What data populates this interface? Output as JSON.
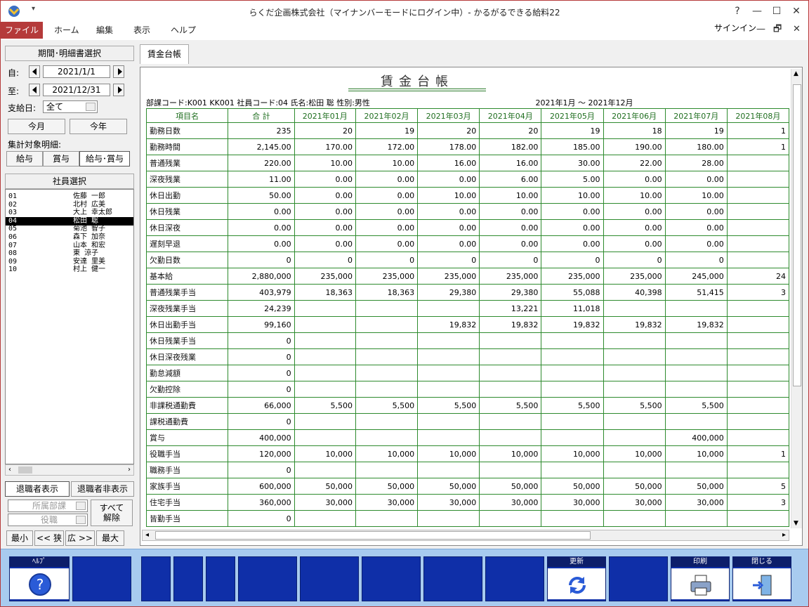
{
  "window": {
    "title": "らくだ企画株式会社（マイナンバーモードにログイン中）- かるがるできる給料22",
    "help_btn": "?",
    "min_btn": "—",
    "max_btn": "☐",
    "close_btn": "✕"
  },
  "menu": {
    "file": "ファイル",
    "home": "ホーム",
    "edit": "編集",
    "view": "表示",
    "help": "ヘルプ",
    "signin": "サインイン",
    "sub_min": "—",
    "sub_max": "🗗",
    "sub_close": "✕"
  },
  "left": {
    "period_head": "期間･明細書選択",
    "from_label": "自:",
    "from_date": "2021/1/1",
    "to_label": "至:",
    "to_date": "2021/12/31",
    "payday_label": "支給日:",
    "payday_value": "全て",
    "this_month": "今月",
    "this_year": "今年",
    "target_label": "集計対象明細:",
    "salary": "給与",
    "bonus": "賞与",
    "salary_bonus": "給与･賞与",
    "emp_head": "社員選択",
    "employees": [
      {
        "code": "01",
        "name": "佐藤 一郎"
      },
      {
        "code": "02",
        "name": "北村 広美"
      },
      {
        "code": "03",
        "name": "大上 幸太郎"
      },
      {
        "code": "04",
        "name": "松田 聡"
      },
      {
        "code": "05",
        "name": "菊池 智子"
      },
      {
        "code": "06",
        "name": "森下 加奈"
      },
      {
        "code": "07",
        "name": "山本 和宏"
      },
      {
        "code": "08",
        "name": "東 涼子"
      },
      {
        "code": "09",
        "name": "安達 里美"
      },
      {
        "code": "10",
        "name": "村上 健一"
      }
    ],
    "retired_show": "退職者表示",
    "retired_hide": "退職者非表示",
    "dept_placeholder": "所属部課",
    "role_placeholder": "役職",
    "clear_all": "すべて\n解除",
    "zoom_min": "最小",
    "zoom_narrow": "<< 狭",
    "zoom_wide": "広 >>",
    "zoom_max": "最大"
  },
  "sheet": {
    "tab": "賃金台帳",
    "title": "賃金台帳",
    "info": "部課コード:K001 KK001  社員コード:04  氏名:松田 聡  性別:男性",
    "period": "2021年1月 〜 2021年12月",
    "headers": [
      "項目名",
      "合 計",
      "2021年01月",
      "2021年02月",
      "2021年03月",
      "2021年04月",
      "2021年05月",
      "2021年06月",
      "2021年07月",
      "2021年08月"
    ],
    "rows": [
      [
        "勤務日数",
        "235",
        "20",
        "19",
        "20",
        "20",
        "19",
        "18",
        "19",
        "1"
      ],
      [
        "勤務時間",
        "2,145.00",
        "170.00",
        "172.00",
        "178.00",
        "182.00",
        "185.00",
        "190.00",
        "180.00",
        "1"
      ],
      [
        "普通残業",
        "220.00",
        "10.00",
        "10.00",
        "16.00",
        "16.00",
        "30.00",
        "22.00",
        "28.00",
        ""
      ],
      [
        "深夜残業",
        "11.00",
        "0.00",
        "0.00",
        "0.00",
        "6.00",
        "5.00",
        "0.00",
        "0.00",
        ""
      ],
      [
        "休日出勤",
        "50.00",
        "0.00",
        "0.00",
        "10.00",
        "10.00",
        "10.00",
        "10.00",
        "10.00",
        ""
      ],
      [
        "休日残業",
        "0.00",
        "0.00",
        "0.00",
        "0.00",
        "0.00",
        "0.00",
        "0.00",
        "0.00",
        ""
      ],
      [
        "休日深夜",
        "0.00",
        "0.00",
        "0.00",
        "0.00",
        "0.00",
        "0.00",
        "0.00",
        "0.00",
        ""
      ],
      [
        "遅刻早退",
        "0.00",
        "0.00",
        "0.00",
        "0.00",
        "0.00",
        "0.00",
        "0.00",
        "0.00",
        ""
      ],
      [
        "欠勤日数",
        "0",
        "0",
        "0",
        "0",
        "0",
        "0",
        "0",
        "0",
        ""
      ],
      [
        "基本給",
        "2,880,000",
        "235,000",
        "235,000",
        "235,000",
        "235,000",
        "235,000",
        "235,000",
        "245,000",
        "24"
      ],
      [
        "普通残業手当",
        "403,979",
        "18,363",
        "18,363",
        "29,380",
        "29,380",
        "55,088",
        "40,398",
        "51,415",
        "3"
      ],
      [
        "深夜残業手当",
        "24,239",
        "",
        "",
        "",
        "13,221",
        "11,018",
        "",
        "",
        ""
      ],
      [
        "休日出勤手当",
        "99,160",
        "",
        "",
        "19,832",
        "19,832",
        "19,832",
        "19,832",
        "19,832",
        ""
      ],
      [
        "休日残業手当",
        "0",
        "",
        "",
        "",
        "",
        "",
        "",
        "",
        ""
      ],
      [
        "休日深夜残業",
        "0",
        "",
        "",
        "",
        "",
        "",
        "",
        "",
        ""
      ],
      [
        "勤怠減額",
        "0",
        "",
        "",
        "",
        "",
        "",
        "",
        "",
        ""
      ],
      [
        "欠勤控除",
        "0",
        "",
        "",
        "",
        "",
        "",
        "",
        "",
        ""
      ],
      [
        "非課税通勤費",
        "66,000",
        "5,500",
        "5,500",
        "5,500",
        "5,500",
        "5,500",
        "5,500",
        "5,500",
        ""
      ],
      [
        "課税通勤費",
        "0",
        "",
        "",
        "",
        "",
        "",
        "",
        "",
        ""
      ],
      [
        "賞与",
        "400,000",
        "",
        "",
        "",
        "",
        "",
        "",
        "400,000",
        ""
      ],
      [
        "役職手当",
        "120,000",
        "10,000",
        "10,000",
        "10,000",
        "10,000",
        "10,000",
        "10,000",
        "10,000",
        "1"
      ],
      [
        "職務手当",
        "0",
        "",
        "",
        "",
        "",
        "",
        "",
        "",
        ""
      ],
      [
        "家族手当",
        "600,000",
        "50,000",
        "50,000",
        "50,000",
        "50,000",
        "50,000",
        "50,000",
        "50,000",
        "5"
      ],
      [
        "住宅手当",
        "360,000",
        "30,000",
        "30,000",
        "30,000",
        "30,000",
        "30,000",
        "30,000",
        "30,000",
        "3"
      ],
      [
        "皆勤手当",
        "0",
        "",
        "",
        "",
        "",
        "",
        "",
        "",
        ""
      ]
    ]
  },
  "toolbar": {
    "help": "ﾍﾙﾌﾟ",
    "update": "更新",
    "print": "印刷",
    "close": "閉じる"
  },
  "colors": {
    "accent": "#b53a3a",
    "grid": "#2e8b2e",
    "fkey": "#0f2fa8",
    "toolbar_bg": "#a8cbef"
  }
}
